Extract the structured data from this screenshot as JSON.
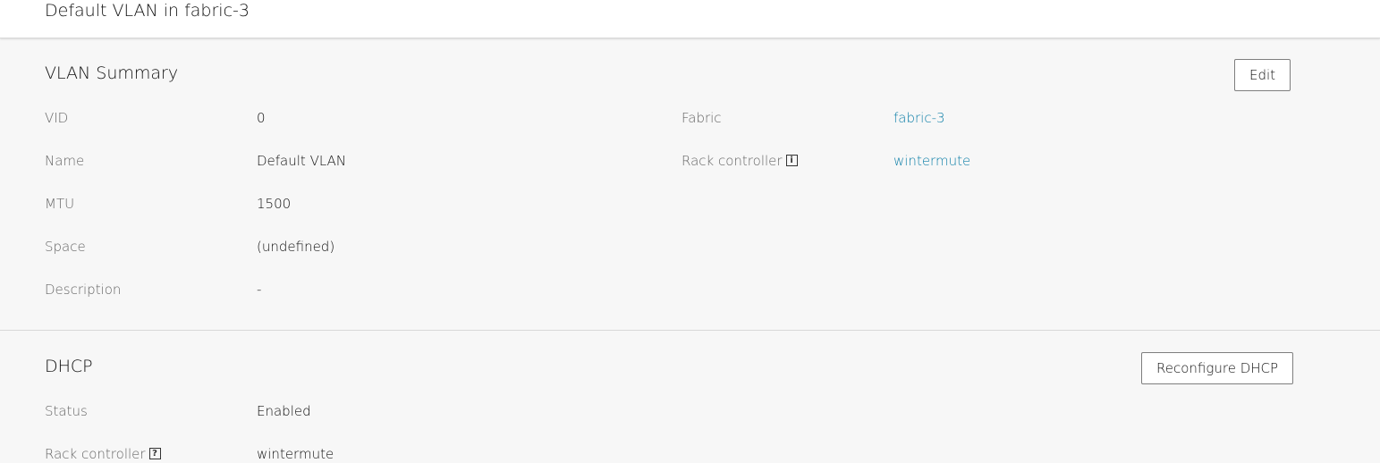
{
  "header": {
    "title": "Default VLAN in fabric-3"
  },
  "vlan_summary": {
    "title": "VLAN Summary",
    "edit_label": "Edit",
    "left_rows": [
      {
        "label": "VID",
        "value": "0"
      },
      {
        "label": "Name",
        "value": "Default VLAN"
      },
      {
        "label": "MTU",
        "value": "1500"
      },
      {
        "label": "Space",
        "value": "(undefined)"
      },
      {
        "label": "Description",
        "value": "-"
      }
    ],
    "right_rows": [
      {
        "label": "Fabric",
        "value": "fabric-3"
      },
      {
        "label": "Rack controller",
        "value": "wintermute",
        "icon": "info-icon",
        "icon_glyph": "i"
      }
    ]
  },
  "dhcp": {
    "title": "DHCP",
    "reconfigure_label": "Reconfigure DHCP",
    "rows": [
      {
        "label": "Status",
        "value": "Enabled"
      },
      {
        "label": "Rack controller",
        "value": "wintermute",
        "icon": "help-icon",
        "icon_glyph": "?"
      }
    ]
  },
  "colors": {
    "link": "#0e7fa8",
    "background": "#f7f7f7",
    "header_bg": "#ffffff"
  }
}
